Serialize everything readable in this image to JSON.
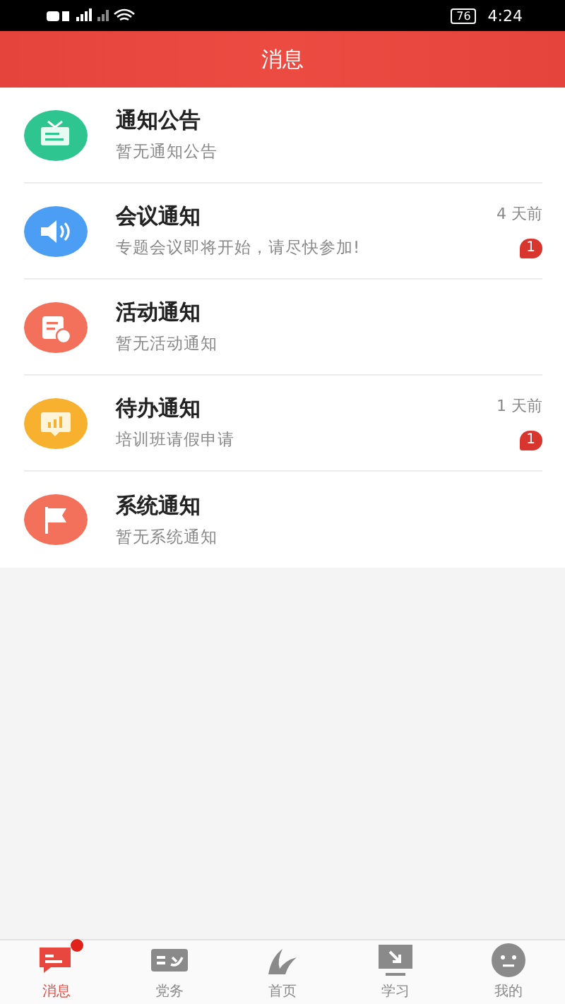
{
  "status_bar": {
    "battery": "76",
    "time": "4:24"
  },
  "header": {
    "title": "消息"
  },
  "messages": [
    {
      "title": "通知公告",
      "subtitle": "暂无通知公告",
      "color": "#2fc591"
    },
    {
      "title": "会议通知",
      "subtitle": "专题会议即将开始，请尽快参加!",
      "time": "4 天前",
      "badge": "1",
      "color": "#4b9ef3"
    },
    {
      "title": "活动通知",
      "subtitle": "暂无活动通知",
      "color": "#f3705a"
    },
    {
      "title": "待办通知",
      "subtitle": "培训班请假申请",
      "time": "1 天前",
      "badge": "1",
      "color": "#f7b12f"
    },
    {
      "title": "系统通知",
      "subtitle": "暂无系统通知",
      "color": "#f3705a"
    }
  ],
  "tabs": [
    {
      "label": "消息",
      "selected": true,
      "dot": true
    },
    {
      "label": "党务",
      "selected": false,
      "dot": false
    },
    {
      "label": "首页",
      "selected": false,
      "dot": false
    },
    {
      "label": "学习",
      "selected": false,
      "dot": false
    },
    {
      "label": "我的",
      "selected": false,
      "dot": false
    }
  ]
}
